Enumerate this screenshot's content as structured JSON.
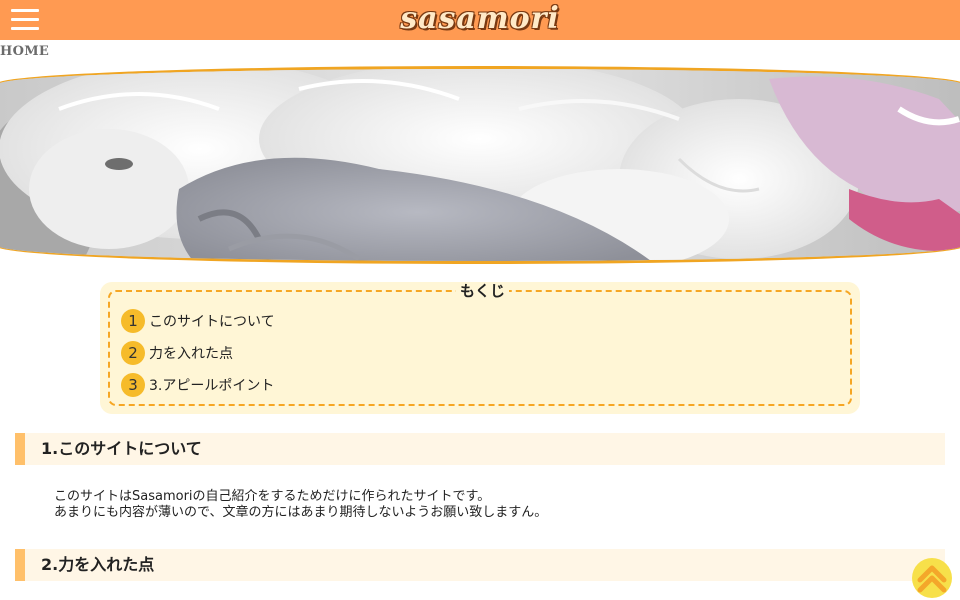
{
  "header": {
    "logo_text": "sasamori",
    "menu_icon": "hamburger-menu-icon",
    "background_color": "#ff9a52"
  },
  "breadcrumb": {
    "home_label": "HOME"
  },
  "hero": {
    "border_color": "#f0a522"
  },
  "toc": {
    "title": "もくじ",
    "items": [
      {
        "number": "1",
        "label": "このサイトについて"
      },
      {
        "number": "2",
        "label": "力を入れた点"
      },
      {
        "number": "3",
        "label": "3.アピールポイント"
      }
    ]
  },
  "sections": [
    {
      "heading": "1.このサイトについて",
      "paragraphs": [
        "このサイトはSasamoriの自己紹介をするためだけに作られたサイトです。",
        "あまりにも内容が薄いので、文章の方にはあまり期待しないようお願い致しますん。"
      ]
    },
    {
      "heading": "2.力を入れた点"
    }
  ],
  "back_to_top": {
    "icon": "double-chevron-up-icon",
    "color": "#f7e04a"
  }
}
